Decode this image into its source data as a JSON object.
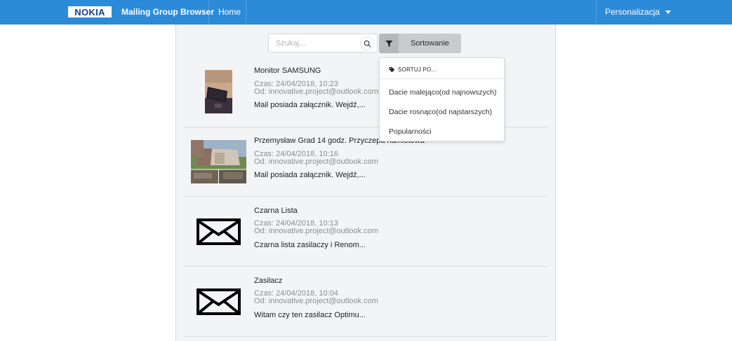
{
  "navbar": {
    "logo_text": "NOKIA",
    "brand": "Mailing Group Browser",
    "home": "Home",
    "personalize": "Personalizacja",
    "color": "#2c8bd8"
  },
  "search": {
    "placeholder": "Szukaj...",
    "value": ""
  },
  "sort": {
    "button_label": "Sortowanie",
    "header": "SORTUJ PO...",
    "options": [
      "Dacie malejąco(od najnowszych)",
      "Dacie rosnąco(od najstarszych)",
      "Popularności"
    ]
  },
  "mails": [
    {
      "title": "Monitor SAMSUNG",
      "time": "Czas: 24/04/2018, 10:23",
      "from": "Od: innovative.project@outlook.com",
      "body": "Mail posiada załącznik. Wejdź,...",
      "thumb": "photo-monitor"
    },
    {
      "title": "Przemysław Grad 14 godz. Przyczepa namiotowa",
      "time": "Czas: 24/04/2018, 10:16",
      "from": "Od: innovative.project@outlook.com",
      "body": "Mail posiada załącznik. Wejdź,...",
      "thumb": "photo-trailer"
    },
    {
      "title": "Czarna Lista",
      "time": "Czas: 24/04/2018, 10:13",
      "from": "Od: innovative.project@outlook.com",
      "body": "Czarna lista zasilaczy i Renom...",
      "thumb": "envelope-icon"
    },
    {
      "title": "Zasilacz",
      "time": "Czas: 24/04/2018, 10:04",
      "from": "Od: innovative.project@outlook.com",
      "body": "Witam czy ten zasilacz Optimu...",
      "thumb": "envelope-icon"
    }
  ]
}
